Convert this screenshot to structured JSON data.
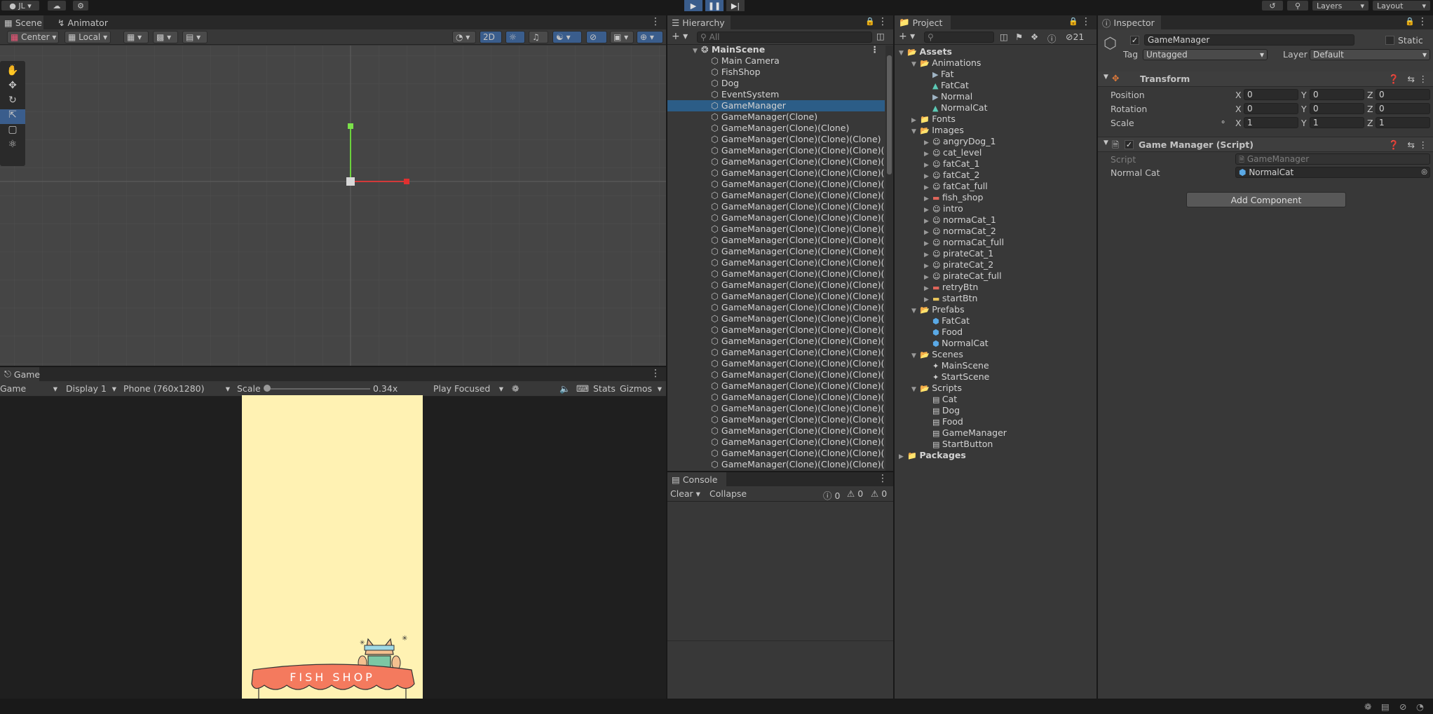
{
  "topbar": {
    "account": "JL",
    "layers": "Layers",
    "layout": "Layout"
  },
  "scene": {
    "tabs": [
      "Scene",
      "Animator"
    ],
    "pivot": "Center",
    "space": "Local",
    "mode2d": "2D"
  },
  "game": {
    "tab": "Game",
    "mode": "Game",
    "display": "Display 1",
    "resolution": "Phone (760x1280)",
    "scale_label": "Scale",
    "scale_value": "0.34x",
    "play_mode": "Play Focused",
    "stats": "Stats",
    "gizmos": "Gizmos",
    "sign": "FISH SHOP"
  },
  "hierarchy": {
    "tab": "Hierarchy",
    "search": "All",
    "scene": "MainScene",
    "items": [
      "Main Camera",
      "FishShop",
      "Dog",
      "EventSystem",
      "GameManager",
      "GameManager(Clone)",
      "GameManager(Clone)(Clone)",
      "GameManager(Clone)(Clone)(Clone)",
      "GameManager(Clone)(Clone)(Clone)(Clo",
      "GameManager(Clone)(Clone)(Clone)(Clo",
      "GameManager(Clone)(Clone)(Clone)(Clo",
      "GameManager(Clone)(Clone)(Clone)(Clo",
      "GameManager(Clone)(Clone)(Clone)(Clo",
      "GameManager(Clone)(Clone)(Clone)(Clo",
      "GameManager(Clone)(Clone)(Clone)(Clo",
      "GameManager(Clone)(Clone)(Clone)(Clo",
      "GameManager(Clone)(Clone)(Clone)(Clo",
      "GameManager(Clone)(Clone)(Clone)(Clo",
      "GameManager(Clone)(Clone)(Clone)(Clo",
      "GameManager(Clone)(Clone)(Clone)(Clo",
      "GameManager(Clone)(Clone)(Clone)(Clo",
      "GameManager(Clone)(Clone)(Clone)(Clo",
      "GameManager(Clone)(Clone)(Clone)(Clo",
      "GameManager(Clone)(Clone)(Clone)(Clo",
      "GameManager(Clone)(Clone)(Clone)(Clo",
      "GameManager(Clone)(Clone)(Clone)(Clo",
      "GameManager(Clone)(Clone)(Clone)(Clo",
      "GameManager(Clone)(Clone)(Clone)(Clo",
      "GameManager(Clone)(Clone)(Clone)(Clo",
      "GameManager(Clone)(Clone)(Clone)(Clo",
      "GameManager(Clone)(Clone)(Clone)(Clo",
      "GameManager(Clone)(Clone)(Clone)(Clo",
      "GameManager(Clone)(Clone)(Clone)(Clo",
      "GameManager(Clone)(Clone)(Clone)(Clo",
      "GameManager(Clone)(Clone)(Clone)(Clo",
      "GameManager(Clone)(Clone)(Clone)(Clo",
      "GameManager(Clone)(Clone)(Clone)(Clo"
    ],
    "selected": "GameManager"
  },
  "console": {
    "tab": "Console",
    "clear": "Clear",
    "collapse": "Collapse",
    "info": "0",
    "warn": "0",
    "error": "0"
  },
  "project": {
    "tab": "Project",
    "hidden_count": "21",
    "rows": [
      {
        "label": "Assets",
        "depth": 0,
        "kind": "folder-open",
        "bold": true
      },
      {
        "label": "Animations",
        "depth": 1,
        "kind": "folder-open"
      },
      {
        "label": "Fat",
        "depth": 2,
        "kind": "anim"
      },
      {
        "label": "FatCat",
        "depth": 2,
        "kind": "clip"
      },
      {
        "label": "Normal",
        "depth": 2,
        "kind": "anim"
      },
      {
        "label": "NormalCat",
        "depth": 2,
        "kind": "clip"
      },
      {
        "label": "Fonts",
        "depth": 1,
        "kind": "folder"
      },
      {
        "label": "Images",
        "depth": 1,
        "kind": "folder-open"
      },
      {
        "label": "angryDog_1",
        "depth": 2,
        "kind": "sprite"
      },
      {
        "label": "cat_level",
        "depth": 2,
        "kind": "sprite"
      },
      {
        "label": "fatCat_1",
        "depth": 2,
        "kind": "sprite"
      },
      {
        "label": "fatCat_2",
        "depth": 2,
        "kind": "sprite"
      },
      {
        "label": "fatCat_full",
        "depth": 2,
        "kind": "sprite"
      },
      {
        "label": "fish_shop",
        "depth": 2,
        "kind": "sprite-red"
      },
      {
        "label": "intro",
        "depth": 2,
        "kind": "sprite"
      },
      {
        "label": "normaCat_1",
        "depth": 2,
        "kind": "sprite"
      },
      {
        "label": "normaCat_2",
        "depth": 2,
        "kind": "sprite"
      },
      {
        "label": "normaCat_full",
        "depth": 2,
        "kind": "sprite"
      },
      {
        "label": "pirateCat_1",
        "depth": 2,
        "kind": "sprite"
      },
      {
        "label": "pirateCat_2",
        "depth": 2,
        "kind": "sprite"
      },
      {
        "label": "pirateCat_full",
        "depth": 2,
        "kind": "sprite"
      },
      {
        "label": "retryBtn",
        "depth": 2,
        "kind": "sprite-red"
      },
      {
        "label": "startBtn",
        "depth": 2,
        "kind": "sprite-yellow"
      },
      {
        "label": "Prefabs",
        "depth": 1,
        "kind": "folder-open"
      },
      {
        "label": "FatCat",
        "depth": 2,
        "kind": "prefab"
      },
      {
        "label": "Food",
        "depth": 2,
        "kind": "prefab"
      },
      {
        "label": "NormalCat",
        "depth": 2,
        "kind": "prefab"
      },
      {
        "label": "Scenes",
        "depth": 1,
        "kind": "folder-open"
      },
      {
        "label": "MainScene",
        "depth": 2,
        "kind": "scene"
      },
      {
        "label": "StartScene",
        "depth": 2,
        "kind": "scene"
      },
      {
        "label": "Scripts",
        "depth": 1,
        "kind": "folder-open"
      },
      {
        "label": "Cat",
        "depth": 2,
        "kind": "script"
      },
      {
        "label": "Dog",
        "depth": 2,
        "kind": "script"
      },
      {
        "label": "Food",
        "depth": 2,
        "kind": "script"
      },
      {
        "label": "GameManager",
        "depth": 2,
        "kind": "script"
      },
      {
        "label": "StartButton",
        "depth": 2,
        "kind": "script"
      },
      {
        "label": "Packages",
        "depth": 0,
        "kind": "folder",
        "bold": true
      }
    ]
  },
  "inspector": {
    "tab": "Inspector",
    "object_name": "GameManager",
    "static": "Static",
    "tag_label": "Tag",
    "tag": "Untagged",
    "layer_label": "Layer",
    "layer": "Default",
    "transform": {
      "title": "Transform",
      "position": "Position",
      "rotation": "Rotation",
      "scale": "Scale",
      "px": "0",
      "py": "0",
      "pz": "0",
      "rx": "0",
      "ry": "0",
      "rz": "0",
      "sx": "1",
      "sy": "1",
      "sz": "1",
      "x": "X",
      "y": "Y",
      "z": "Z"
    },
    "script_comp": {
      "title": "Game Manager (Script)",
      "script_label": "Script",
      "script_value": "GameManager",
      "field_label": "Normal Cat",
      "field_value": "NormalCat"
    },
    "add_component": "Add Component"
  },
  "colors": {
    "accent": "#3a5d8c",
    "game_bg": "#fff2b3",
    "sign": "#f47a5e",
    "selected_row": "#2c5d87"
  }
}
